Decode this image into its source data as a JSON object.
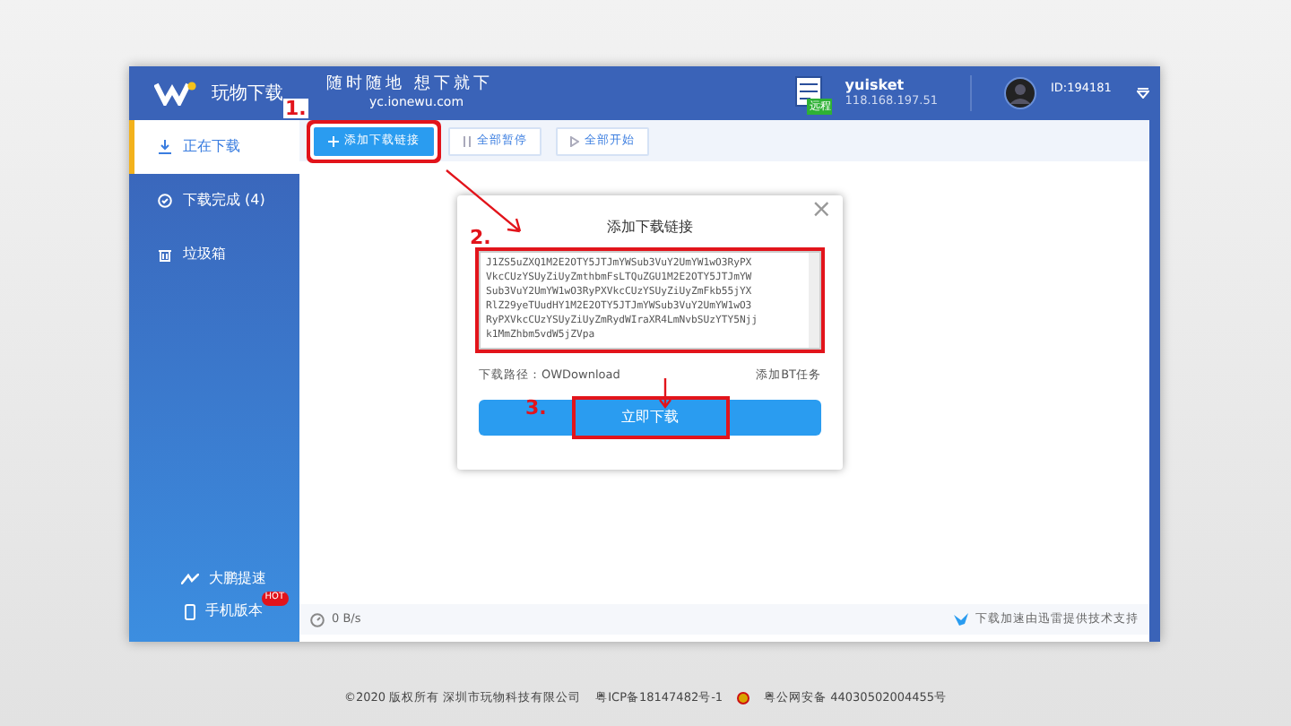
{
  "header": {
    "app_name": "玩物下载",
    "slogan": "随时随地 想下就下",
    "site": "yc.ionewu.com",
    "remote_badge": "远程",
    "user": "yuisket",
    "ip": "118.168.197.51",
    "user_id": "ID:194181"
  },
  "toolbar": [
    {
      "label": "添加下载链接",
      "kind": "add",
      "highlighted": true
    },
    {
      "label": "全部暂停",
      "kind": "pause",
      "highlighted": false
    },
    {
      "label": "全部开始",
      "kind": "start",
      "highlighted": false
    }
  ],
  "sidebar": {
    "items": [
      {
        "label": "正在下载",
        "kind": "download",
        "selected": true
      },
      {
        "label": "下载完成 (4)",
        "kind": "done",
        "selected": false
      },
      {
        "label": "垃圾箱",
        "kind": "trash",
        "selected": false
      }
    ],
    "bottom": [
      {
        "label": "大鹏提速",
        "kind": "speed"
      },
      {
        "label": "手机版本",
        "kind": "phone",
        "badge": "HOT"
      }
    ]
  },
  "dialog": {
    "title": "添加下载链接",
    "close": "×",
    "links": [
      "J1ZS5uZXQ1M2E2OTY5JTJmYWSub3VuY2UmYW1wO3RyPX",
      "VkcCUzYSUyZiUyZmthbmFsLTQuZGU1M2E2OTY5JTJmYW",
      "Sub3VuY2UmYW1wO3RyPXVkcCUzYSUyZiUyZmFkb55jYX",
      "RlZ29yeTUudHY1M2E2OTY5JTJmYWSub3VuY2UmYW1wO3",
      "RyPXVkcCUzYSUyZiUyZmRydWIraXR4LmNvbSUzYTY5Njj",
      "k1MmZhbm5vdW5jZVpa"
    ],
    "path_label": "下载路径：",
    "path": "OWDownload",
    "bt_link": "添加BT任务",
    "submit": "立即下载",
    "submit_highlighted": true
  },
  "status_bar": {
    "speed": "0 B/s",
    "credit": "下载加速由迅雷提供技术支持"
  },
  "annotations": [
    {
      "text": "1."
    },
    {
      "text": "2."
    },
    {
      "text": "3."
    }
  ],
  "footer": [
    "©2020 版权所有 深圳市玩物科技有限公司",
    "粤ICP备18147482号-1",
    "粤公网安备 44030502004455号"
  ]
}
